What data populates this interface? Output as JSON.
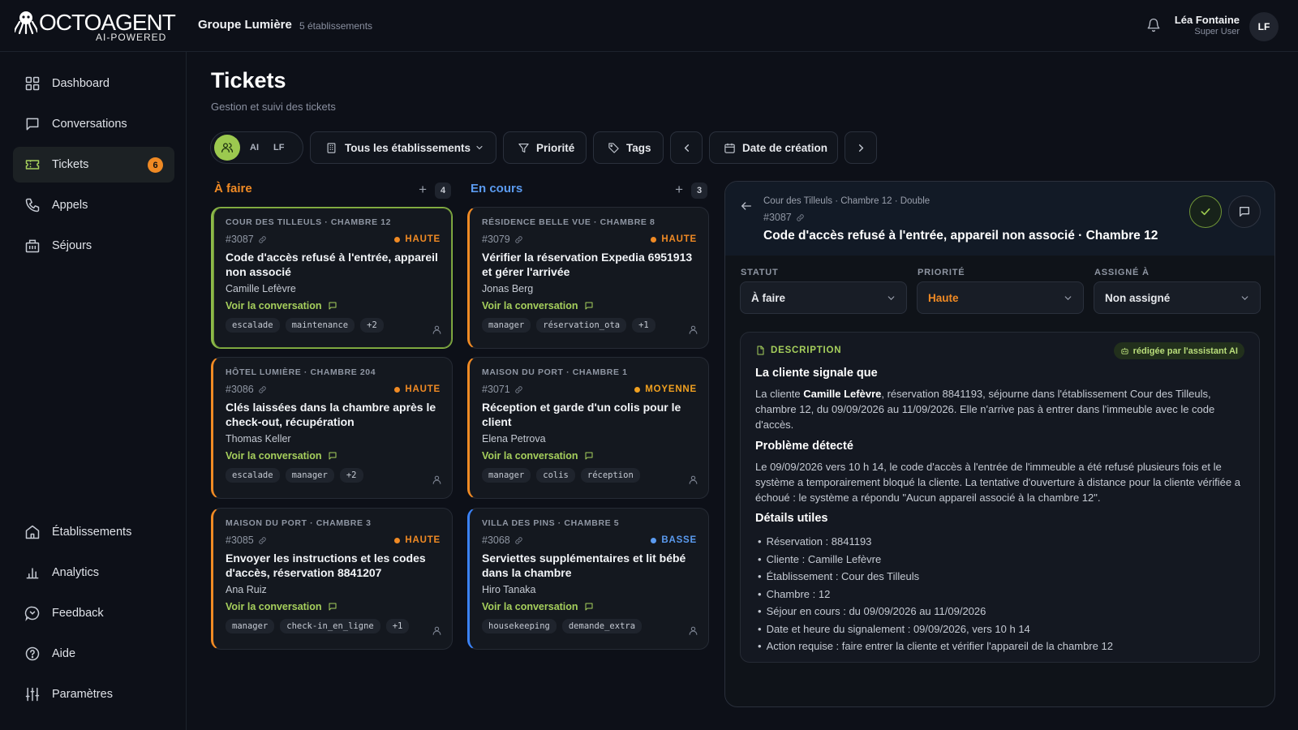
{
  "header": {
    "logo_text": "OCTOAGENT",
    "logo_sub": "AI-POWERED",
    "org_name": "Groupe Lumière",
    "org_count": "5 établissements",
    "user_name": "Léa Fontaine",
    "user_role": "Super User",
    "user_initials": "LF"
  },
  "sidebar": {
    "items": [
      {
        "label": "Dashboard",
        "icon": "grid-icon"
      },
      {
        "label": "Conversations",
        "icon": "message-icon"
      },
      {
        "label": "Tickets",
        "icon": "ticket-icon",
        "badge": "6"
      },
      {
        "label": "Appels",
        "icon": "phone-icon"
      },
      {
        "label": "Séjours",
        "icon": "building-icon"
      }
    ],
    "bottom_items": [
      {
        "label": "Établissements",
        "icon": "home-icon"
      },
      {
        "label": "Analytics",
        "icon": "bar-chart-icon"
      },
      {
        "label": "Feedback",
        "icon": "feedback-icon"
      },
      {
        "label": "Aide",
        "icon": "help-icon"
      },
      {
        "label": "Paramètres",
        "icon": "sliders-icon"
      }
    ]
  },
  "page": {
    "title": "Tickets",
    "subtitle": "Gestion et suivi des tickets"
  },
  "filters": {
    "user_chips": [
      "AI",
      "LF"
    ],
    "establishments": "Tous les établissements",
    "priority": "Priorité",
    "tags": "Tags",
    "date": "Date de création"
  },
  "columns": [
    {
      "title": "À faire",
      "count": "4",
      "color": "#f08a24"
    },
    {
      "title": "En cours",
      "count": "3",
      "color": "#5b9bf0"
    }
  ],
  "cards": [
    {
      "location": "COUR DES TILLEULS · CHAMBRE 12",
      "id": "#3087",
      "priority": "HAUTE",
      "priority_color": "#f08a24",
      "title": "Code d'accès refusé à l'entrée, appareil non associé",
      "customer": "Camille Lefèvre",
      "conv": "Voir la conversation",
      "tags": [
        "escalade",
        "maintenance",
        "+2"
      ]
    },
    {
      "location": "HÔTEL LUMIÈRE · CHAMBRE 204",
      "id": "#3086",
      "priority": "HAUTE",
      "priority_color": "#f08a24",
      "title": "Clés laissées dans la chambre après le check-out, récupération",
      "customer": "Thomas Keller",
      "conv": "Voir la conversation",
      "tags": [
        "escalade",
        "manager",
        "+2"
      ]
    },
    {
      "location": "MAISON DU PORT · CHAMBRE 3",
      "id": "#3085",
      "priority": "HAUTE",
      "priority_color": "#f08a24",
      "title": "Envoyer les instructions et les codes d'accès, réservation 8841207",
      "customer": "Ana Ruiz",
      "conv": "Voir la conversation",
      "tags": [
        "manager",
        "check-in_en_ligne",
        "+1"
      ]
    },
    {
      "location": "RÉSIDENCE BELLE VUE · CHAMBRE 8",
      "id": "#3079",
      "priority": "HAUTE",
      "priority_color": "#f08a24",
      "title": "Vérifier la réservation Expedia 6951913 et gérer l'arrivée",
      "customer": "Jonas Berg",
      "conv": "Voir la conversation",
      "tags": [
        "manager",
        "réservation_ota",
        "+1"
      ]
    },
    {
      "location": "MAISON DU PORT · CHAMBRE 1",
      "id": "#3071",
      "priority": "MOYENNE",
      "priority_color": "#f0a020",
      "title": "Réception et garde d'un colis pour le client",
      "customer": "Elena Petrova",
      "conv": "Voir la conversation",
      "tags": [
        "manager",
        "colis",
        "réception"
      ]
    },
    {
      "location": "VILLA DES PINS · CHAMBRE 5",
      "id": "#3068",
      "priority": "BASSE",
      "priority_color": "#5b9bf0",
      "title": "Serviettes supplémentaires et lit bébé dans la chambre",
      "customer": "Hiro Tanaka",
      "conv": "Voir la conversation",
      "tags": [
        "housekeeping",
        "demande_extra"
      ]
    }
  ],
  "detail": {
    "location": "Cour des Tilleuls · Chambre 12 · Double",
    "id": "#3087",
    "title": "Code d'accès refusé à l'entrée, appareil non associé · Chambre 12",
    "status_label": "STATUT",
    "status_value": "À faire",
    "priority_label": "PRIORITÉ",
    "priority_value": "Haute",
    "assigned_label": "ASSIGNÉ À",
    "assigned_value": "Non assigné",
    "desc_label": "DESCRIPTION",
    "ai_chip": "rédigée par l'assistant AI",
    "h1": "La cliente signale que",
    "p1_before": "La cliente ",
    "p1_bold": "Camille Lefèvre",
    "p1_after": ", réservation 8841193, séjourne dans l'établissement Cour des Tilleuls, chambre 12, du 09/09/2026 au 11/09/2026. Elle n'arrive pas à entrer dans l'immeuble avec le code d'accès.",
    "h2": "Problème détecté",
    "p2": "Le 09/09/2026 vers 10 h 14, le code d'accès à l'entrée de l'immeuble a été refusé plusieurs fois et le système a temporairement bloqué la cliente. La tentative d'ouverture à distance pour la cliente vérifiée a échoué : le système a répondu \"Aucun appareil associé à la chambre 12\".",
    "h3": "Détails utiles",
    "details": [
      "Réservation : 8841193",
      "Cliente : Camille Lefèvre",
      "Établissement : Cour des Tilleuls",
      "Chambre : 12",
      "Séjour en cours : du 09/09/2026 au 11/09/2026",
      "Date et heure du signalement : 09/09/2026, vers 10 h 14",
      "Action requise : faire entrer la cliente et vérifier l'appareil de la chambre 12"
    ]
  },
  "colors": {
    "accent": "#9cc94f",
    "high": "#f08a24",
    "low": "#5b9bf0",
    "background": "#0d1018"
  }
}
